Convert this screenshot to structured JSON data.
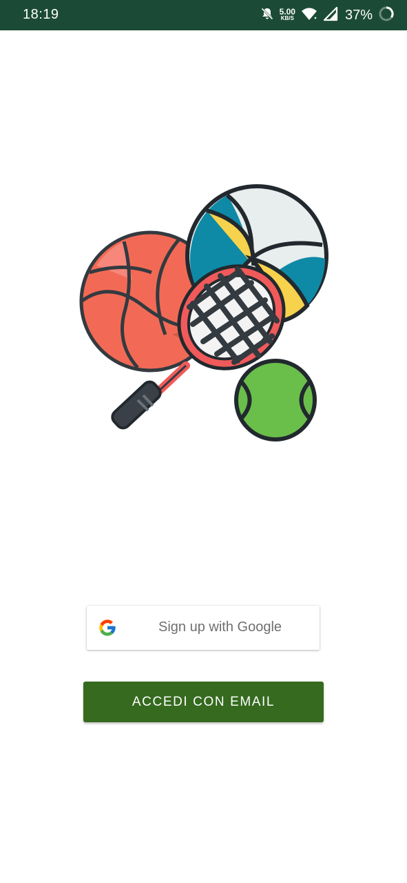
{
  "status_bar": {
    "time": "18:19",
    "net_speed_value": "5.00",
    "net_speed_unit": "KB/S",
    "battery": "37%",
    "icons": [
      "bell-off-icon",
      "wifi-icon",
      "signal-icon",
      "battery-icon"
    ],
    "background": "#1b4b36"
  },
  "hero": {
    "icon": "sports-equipment-illustration"
  },
  "google_button": {
    "label": "Sign up with Google",
    "icon": "google-logo-icon"
  },
  "email_button": {
    "label": "ACCEDI CON EMAIL",
    "color": "#356a1f"
  }
}
